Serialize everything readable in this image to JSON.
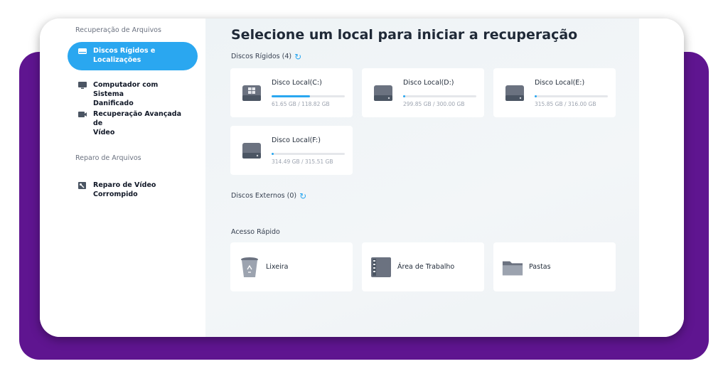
{
  "sidebar": {
    "section_recovery": "Recuperação de Arquivos",
    "items": [
      {
        "label_line1": "Discos Rígidos e",
        "label_line2": "Localizações",
        "icon": "hard-drive-icon",
        "active": true
      },
      {
        "label_line1": "Computador com Sistema",
        "label_line2": "Danificado",
        "icon": "monitor-icon",
        "active": false
      },
      {
        "label_line1": "Recuperação Avançada de",
        "label_line2": "Vídeo",
        "icon": "video-camera-icon",
        "active": false
      }
    ],
    "section_repair": "Reparo de Arquivos",
    "repair_items": [
      {
        "label_line1": "Reparo de Vídeo",
        "label_line2": "Corrompido",
        "icon": "video-repair-icon"
      }
    ]
  },
  "main": {
    "title": "Selecione um local para iniciar a recuperação",
    "hard_disks_label": "Discos Rígidos (4)",
    "external_disks_label": "Discos Externos (0)",
    "quick_access_label": "Acesso Rápido",
    "disks": [
      {
        "name": "Disco Local(C:)",
        "size": "61.65 GB / 118.82 GB",
        "used_fraction": 0.52,
        "system": true
      },
      {
        "name": "Disco Local(D:)",
        "size": "299.85 GB / 300.00 GB",
        "used_fraction": 0.03,
        "system": false
      },
      {
        "name": "Disco Local(E:)",
        "size": "315.85 GB / 316.00 GB",
        "used_fraction": 0.03,
        "system": false
      },
      {
        "name": "Disco Local(F:)",
        "size": "314.49 GB / 315.51 GB",
        "used_fraction": 0.03,
        "system": false
      }
    ],
    "quick_access": [
      {
        "label": "Lixeira",
        "icon": "recycle-bin-icon"
      },
      {
        "label": "Área de Trabalho",
        "icon": "desktop-icon"
      },
      {
        "label": "Pastas",
        "icon": "folder-icon"
      }
    ]
  },
  "colors": {
    "accent": "#2aa7f0",
    "frame": "#5f1590"
  }
}
